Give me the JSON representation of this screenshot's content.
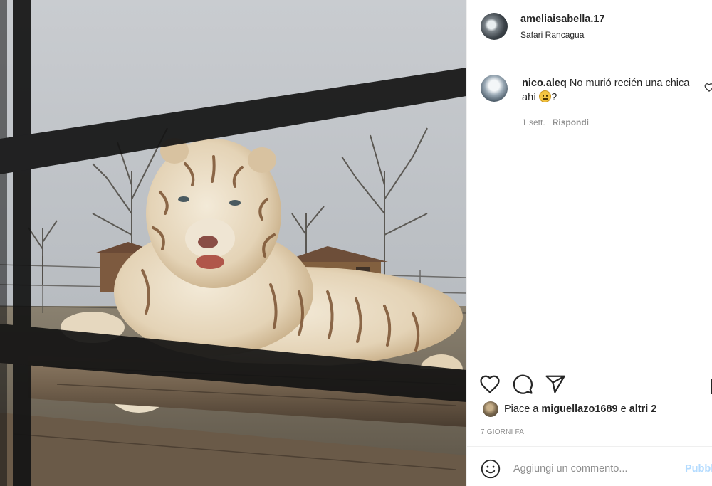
{
  "post": {
    "username": "ameliaisabella.17",
    "location": "Safari Rancagua"
  },
  "comment": {
    "username": "nico.aleq",
    "text": "No murió recién una chica ahí",
    "text_end": "?",
    "time": "1 sett.",
    "reply_label": "Rispondi"
  },
  "icons": {
    "like": "heart-icon",
    "comment": "comment-bubble-icon",
    "share": "paper-plane-icon",
    "save": "bookmark-icon",
    "emoji": "smiley-icon",
    "comment_emoji": "grimacing-face-emoji"
  },
  "likes": {
    "prefix": "Piace a",
    "user": "miguellazo1689",
    "conj": "e",
    "others": "altri 2"
  },
  "time_ago": "7 GIORNI FA",
  "add_comment": {
    "placeholder": "Aggiungi un commento...",
    "publish_label": "Pubblica"
  },
  "colors": {
    "text": "#262626",
    "secondary": "#8e8e8e",
    "publish_disabled": "#b3dbff",
    "border": "#efefef"
  }
}
